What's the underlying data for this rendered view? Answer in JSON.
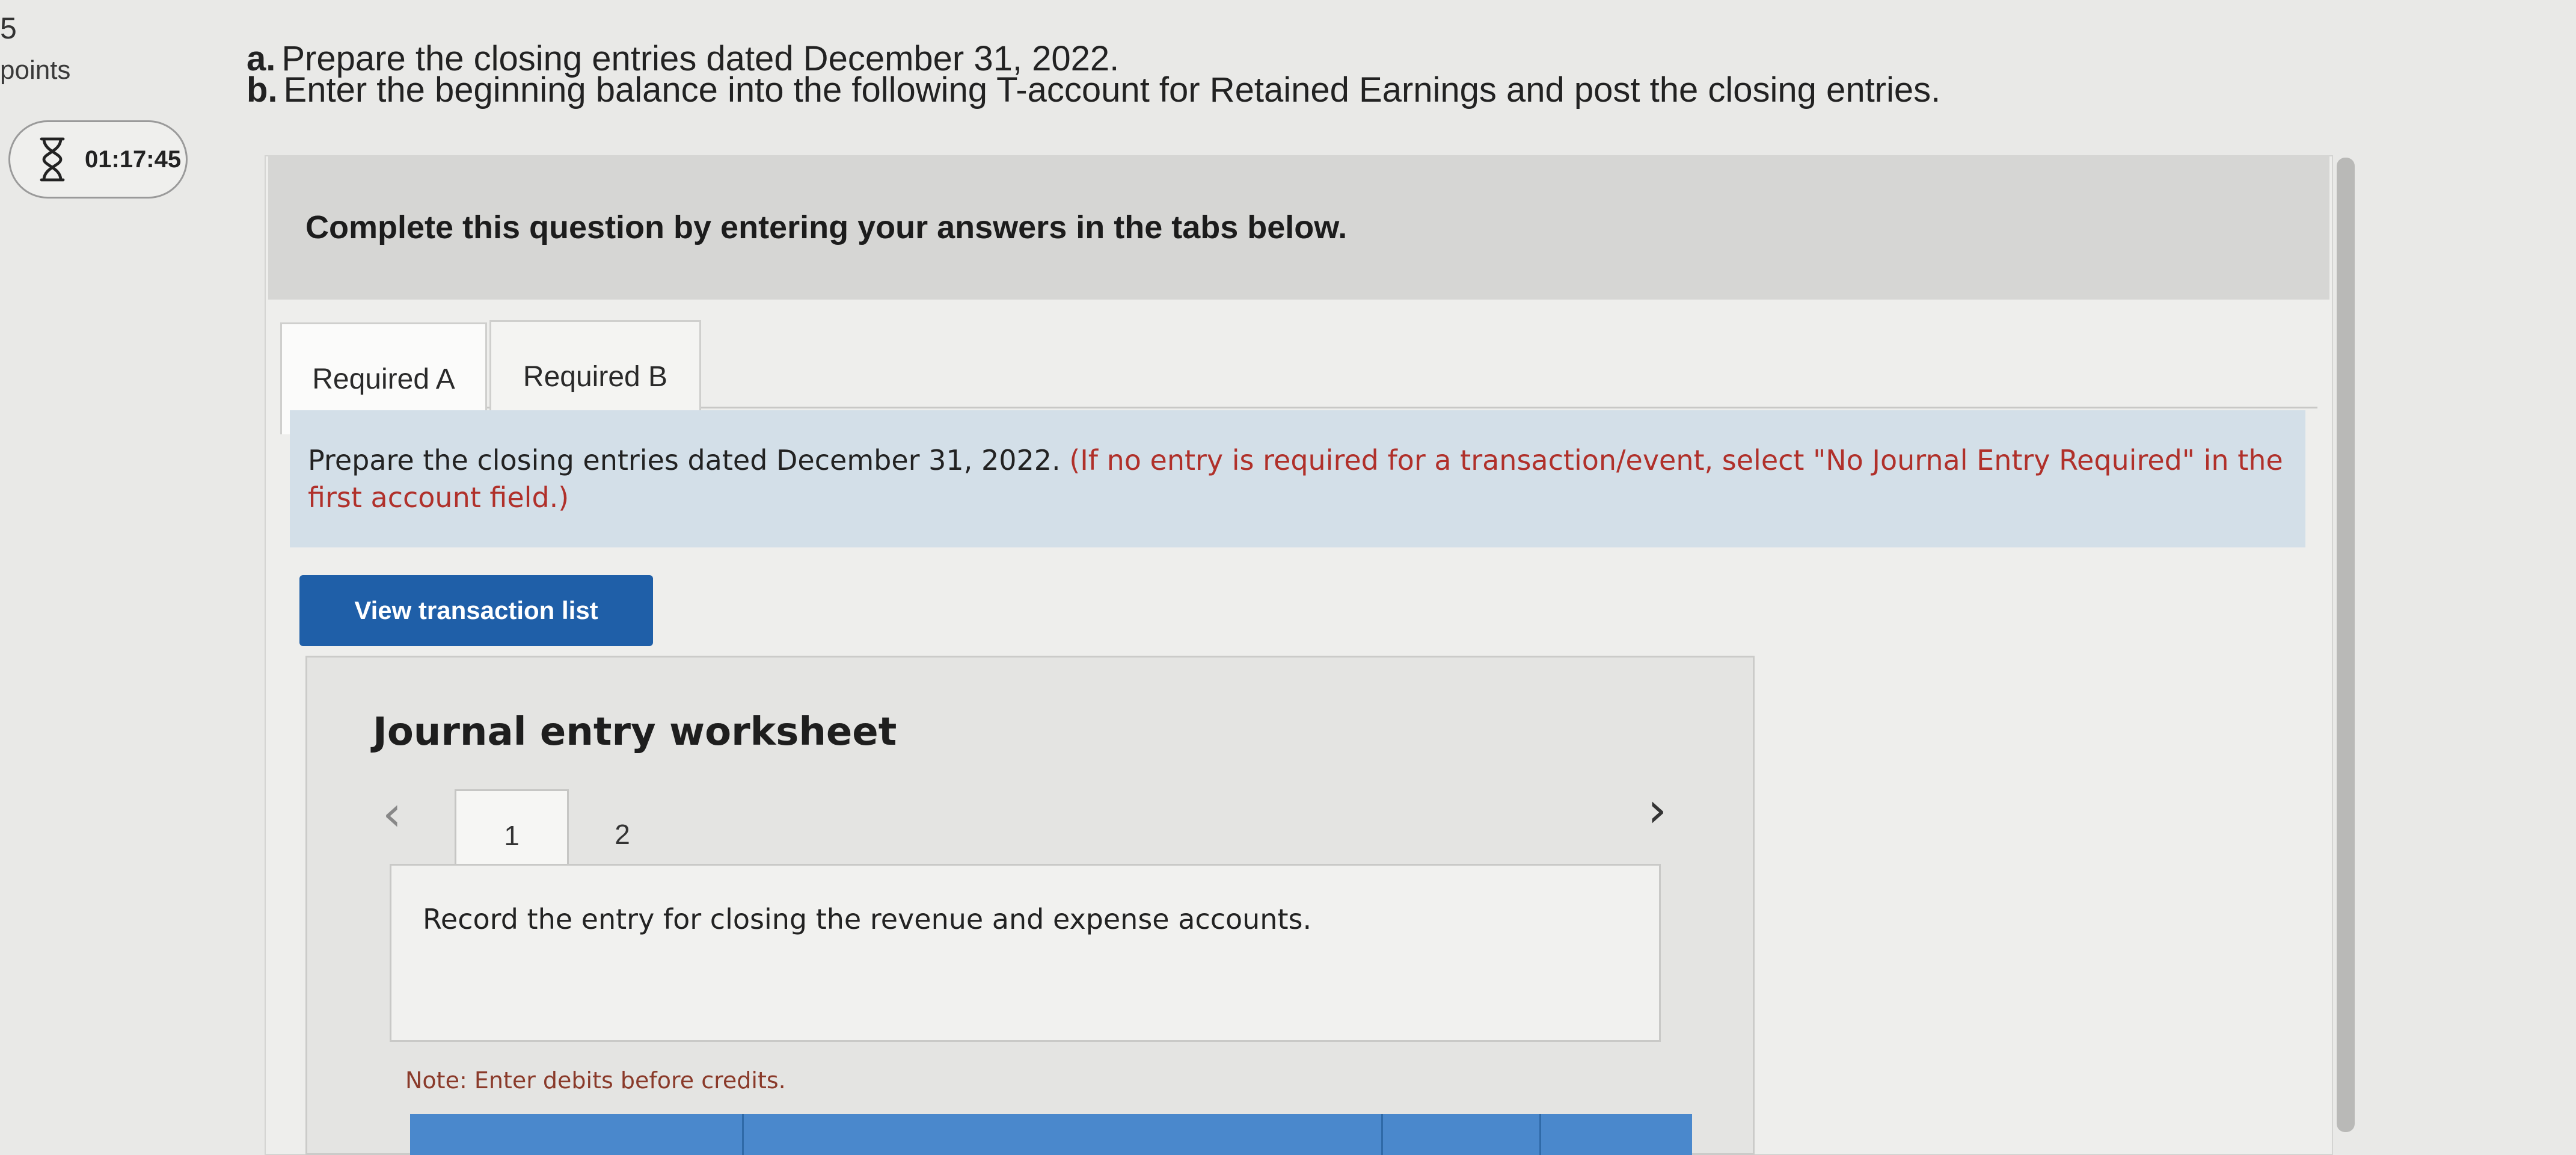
{
  "sidebar": {
    "question_number": "5",
    "points_label": "points",
    "timer": "01:17:45",
    "timer_icon": "hourglass-icon"
  },
  "instructions": {
    "a_marker": "a.",
    "a_text": "Prepare the closing entries dated December 31, 2022.",
    "b_marker": "b.",
    "b_text": "Enter the beginning balance into the  following T-account for Retained Earnings and post the closing entries."
  },
  "question": {
    "header": "Complete this question by entering your answers in the tabs below.",
    "tabs": [
      {
        "label": "Required A"
      },
      {
        "label": "Required B"
      }
    ],
    "banner_main": "Prepare the closing entries dated December 31, 2022.",
    "banner_note": "(If no entry is required for a transaction/event, select \"No Journal Entry Required\" in the first account field.)",
    "view_button": "View transaction list"
  },
  "worksheet": {
    "title": "Journal entry worksheet",
    "prev_icon": "chevron-left-icon",
    "next_icon": "chevron-right-icon",
    "pages": [
      {
        "label": "1"
      },
      {
        "label": "2"
      }
    ],
    "record_text": "Record the entry for closing the revenue and expense accounts.",
    "note": "Note: Enter debits before credits."
  },
  "colors": {
    "button_blue": "#1f5fa8",
    "banner_blue": "#d3dfe8",
    "note_red": "#b0302a"
  }
}
